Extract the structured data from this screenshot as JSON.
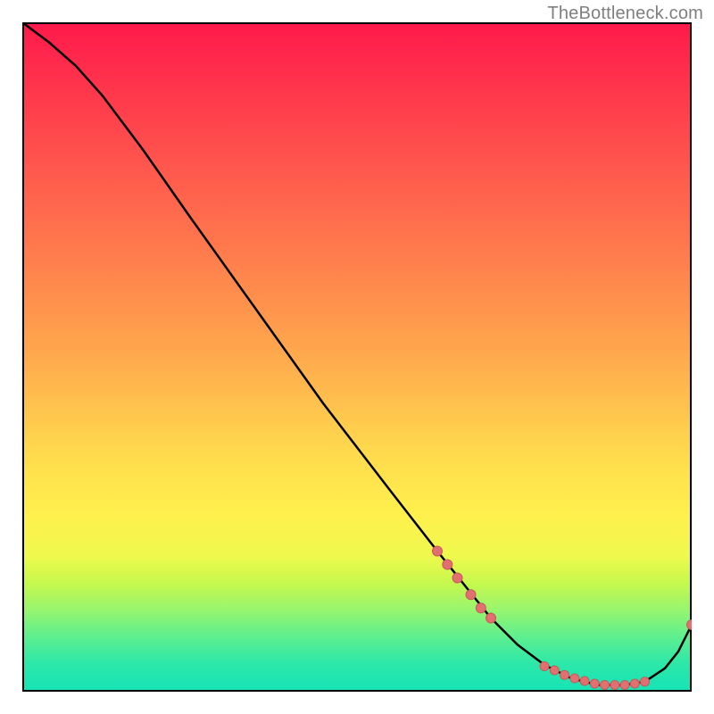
{
  "attribution": "TheBottleneck.com",
  "colors": {
    "curve": "#000000",
    "marker_fill": "#e27070",
    "marker_stroke": "#c85a5a"
  },
  "chart_data": {
    "type": "line",
    "title": "",
    "xlabel": "",
    "ylabel": "",
    "xlim": [
      0,
      100
    ],
    "ylim": [
      0,
      100
    ],
    "curve": [
      {
        "x": 0,
        "y": 100
      },
      {
        "x": 4,
        "y": 97
      },
      {
        "x": 8,
        "y": 93.5
      },
      {
        "x": 12,
        "y": 89
      },
      {
        "x": 18,
        "y": 81
      },
      {
        "x": 25,
        "y": 71
      },
      {
        "x": 35,
        "y": 57
      },
      {
        "x": 45,
        "y": 43
      },
      {
        "x": 55,
        "y": 30
      },
      {
        "x": 62,
        "y": 21
      },
      {
        "x": 66,
        "y": 16
      },
      {
        "x": 70,
        "y": 11
      },
      {
        "x": 74,
        "y": 7
      },
      {
        "x": 78,
        "y": 4
      },
      {
        "x": 82,
        "y": 2
      },
      {
        "x": 86,
        "y": 1.0
      },
      {
        "x": 90,
        "y": 1.0
      },
      {
        "x": 93,
        "y": 1.5
      },
      {
        "x": 96,
        "y": 3.5
      },
      {
        "x": 98,
        "y": 6
      },
      {
        "x": 100,
        "y": 10
      }
    ],
    "markers_upper": [
      {
        "x": 62,
        "y": 21
      },
      {
        "x": 63.5,
        "y": 19
      },
      {
        "x": 65,
        "y": 17
      },
      {
        "x": 67,
        "y": 14.5
      },
      {
        "x": 68.5,
        "y": 12.5
      },
      {
        "x": 70,
        "y": 11
      }
    ],
    "markers_bottom": [
      {
        "x": 78,
        "y": 3.8
      },
      {
        "x": 79.5,
        "y": 3.2
      },
      {
        "x": 81,
        "y": 2.5
      },
      {
        "x": 82.5,
        "y": 2.0
      },
      {
        "x": 84,
        "y": 1.6
      },
      {
        "x": 85.5,
        "y": 1.2
      },
      {
        "x": 87,
        "y": 1.0
      },
      {
        "x": 88.5,
        "y": 1.0
      },
      {
        "x": 90,
        "y": 1.0
      },
      {
        "x": 91.5,
        "y": 1.2
      },
      {
        "x": 93,
        "y": 1.5
      }
    ],
    "marker_end": {
      "x": 100,
      "y": 10
    }
  }
}
